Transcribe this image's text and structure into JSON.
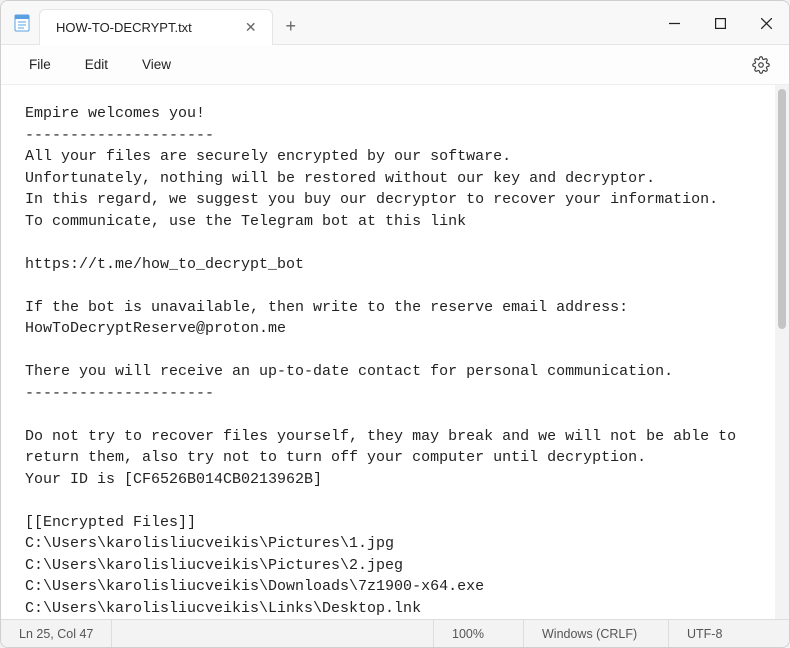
{
  "titlebar": {
    "tab_title": "HOW-TO-DECRYPT.txt"
  },
  "menubar": {
    "file": "File",
    "edit": "Edit",
    "view": "View"
  },
  "document": {
    "text": "Empire welcomes you!\n---------------------\nAll your files are securely encrypted by our software.\nUnfortunately, nothing will be restored without our key and decryptor.\nIn this regard, we suggest you buy our decryptor to recover your information.\nTo communicate, use the Telegram bot at this link\n\nhttps://t.me/how_to_decrypt_bot\n\nIf the bot is unavailable, then write to the reserve email address: HowToDecryptReserve@proton.me\n\nThere you will receive an up-to-date contact for personal communication.\n---------------------\n\nDo not try to recover files yourself, they may break and we will not be able to return them, also try not to turn off your computer until decryption.\nYour ID is [CF6526B014CB0213962B]\n\n[[Encrypted Files]]\nC:\\Users\\karolisliucveikis\\Pictures\\1.jpg\nC:\\Users\\karolisliucveikis\\Pictures\\2.jpeg\nC:\\Users\\karolisliucveikis\\Downloads\\7z1900-x64.exe\nC:\\Users\\karolisliucveikis\\Links\\Desktop.lnk"
  },
  "statusbar": {
    "position": "Ln 25, Col 47",
    "zoom": "100%",
    "line_ending": "Windows (CRLF)",
    "encoding": "UTF-8"
  }
}
